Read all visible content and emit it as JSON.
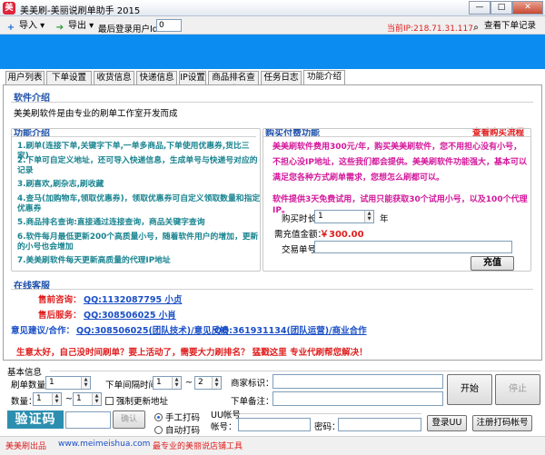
{
  "window": {
    "title": "美美刷-美丽说刷单助手 2015",
    "app_icon_glyph": "美",
    "min_glyph": "—",
    "max_glyph": "□",
    "close_glyph": "✕"
  },
  "toolbar": {
    "import_label": "导入",
    "export_label": "导出",
    "last_user_label": "最后登录用户Id：",
    "last_user_value": "0",
    "current_ip": "当前IP:218.71.31.117",
    "view_orders_label": "查看下单记录"
  },
  "tabs": [
    "用户列表",
    "下单设置",
    "收货信息",
    "快递信息",
    "IP设置",
    "商品排名查询",
    "任务日志",
    "功能介绍"
  ],
  "intro": {
    "software_head": "软件介绍",
    "software_desc": "美美刷软件是由专业的刷单工作室开发而成",
    "features_head": "功能介绍",
    "features": [
      "1.刷单(连接下单,关键字下单,一单多商品,下单使用优惠券,货比三家)",
      "2.下单可自定义地址，还可导入快递信息，生成单号与快递号对应的记录",
      "3.刷喜欢,刷杂志,刷收藏",
      "4.查马(加购物车,领取优惠券)，领取优惠券可自定义领取数量和指定优惠券",
      "5.商品排名查询:直接通过连接查询，商品关键字查询",
      "6.软件每月最低更新200个高质量小号，随着软件用户的增加，更新的小号也会增加",
      "7.美美刷软件每天更新高质量的代理IP地址"
    ]
  },
  "purchase": {
    "head": "购买付费功能",
    "flow_link": "查看购买流程",
    "desc1": "美美刷软件费用300元/年，购买美美刷软件，您不用担心没有小号，不担心没IP地址，这些我们都会提供。美美刷软件功能强大，基本可以满足您各种方式刷单需求，您想怎么刷都可以。",
    "desc2": "软件提供3天免费试用，试用只能获取30个试用小号，以及100个代理IP。",
    "duration_label": "购买时长：",
    "duration_value": "1",
    "duration_unit": "年",
    "amount_label": "需充值金额：",
    "amount_value": "￥300.00",
    "order_label": "交易单号：",
    "order_value": "",
    "recharge_btn": "充值"
  },
  "service": {
    "head": "在线客服",
    "presale_label": "售前咨询：",
    "presale_qq": "QQ:1132087795 小贞",
    "aftersale_label": "售后服务：",
    "aftersale_qq": "QQ:308506025  小肖",
    "feedback_label": "意见建议/合作：",
    "feedback_qq1": "QQ:308506025(团队技术)/意见反馈",
    "feedback_qq2": "QQ:361931134(团队运营)/商业合作",
    "note": "生意太好，自己没时间刷单？要上活动了，需要大力刷排名？ 猛戳这里 专业代刷帮您解决！"
  },
  "basic": {
    "head": "基本信息",
    "count_label": "刷单数量：",
    "count_value": "1",
    "interval_label": "下单间隔时间：",
    "interval_from": "1",
    "interval_tilde": "~",
    "interval_to": "2",
    "qty_label": "数量：",
    "qty_from": "1",
    "qty_tilde": "~",
    "qty_to": "1",
    "force_update_label": "强制更新地址",
    "merchant_label": "商家标识：",
    "merchant_value": "",
    "order_note_label": "下单备注：",
    "order_note_value": "",
    "start_btn": "开始",
    "stop_btn": "停止",
    "captcha_text": "验证码",
    "captcha_input": "",
    "confirm_btn": "确认",
    "manual_label": "手工打码",
    "auto_label": "自动打码",
    "uu_head": "UU帐号",
    "account_label": "帐号：",
    "account_value": "",
    "password_label": "密码：",
    "password_value": "",
    "login_uu_btn": "登录UU",
    "register_btn": "注册打码帐号"
  },
  "status": {
    "left": "美美刷出品",
    "url": "www.meimeishua.com",
    "slogan": "最专业的美丽说店铺工具"
  }
}
